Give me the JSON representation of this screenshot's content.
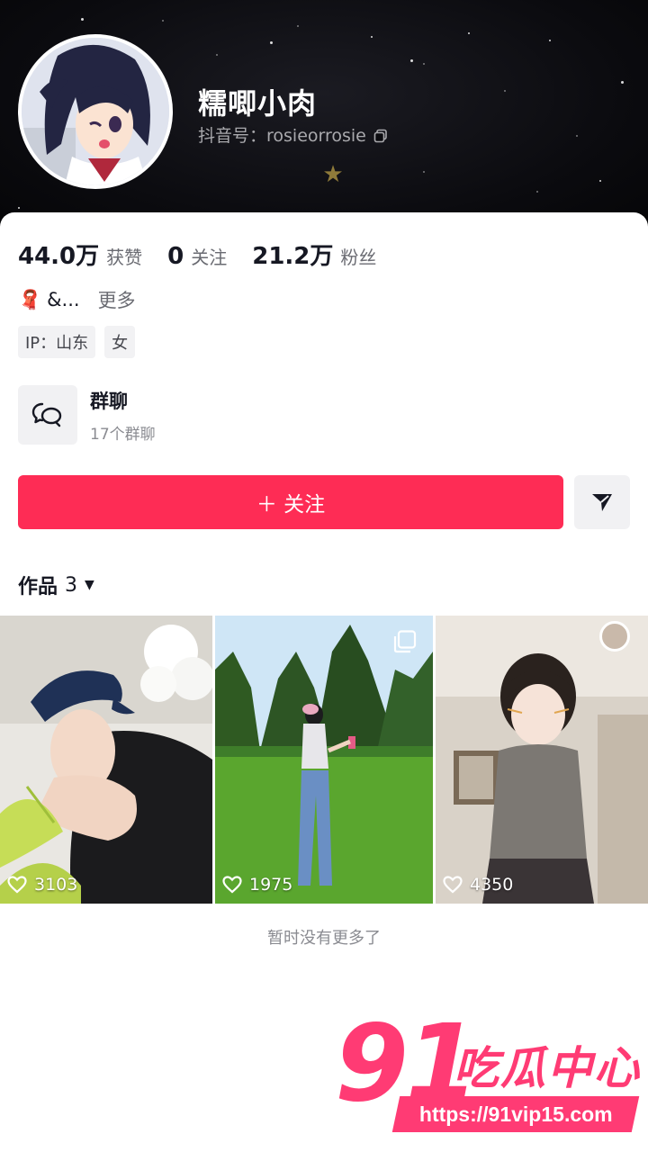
{
  "profile": {
    "name": "糯唧小肉",
    "douyin_id": "抖音号：rosieorrosie"
  },
  "stats": [
    {
      "value": "44.0万",
      "label": "获赞"
    },
    {
      "value": "0",
      "label": "关注"
    },
    {
      "value": "21.2万",
      "label": "粉丝"
    }
  ],
  "bio": {
    "emoji": "🧣",
    "text": "&...",
    "more": "更多"
  },
  "tags": [
    "IP：山东",
    "女"
  ],
  "group_chat": {
    "title": "群聊",
    "subtitle": "17个群聊"
  },
  "actions": {
    "follow": "＋ 关注"
  },
  "works": {
    "label": "作品",
    "count": "3"
  },
  "videos": [
    {
      "likes": "3103"
    },
    {
      "likes": "1975"
    },
    {
      "likes": "4350"
    }
  ],
  "footer": {
    "end_text": "暂时没有更多了"
  },
  "watermark": {
    "number": "91",
    "brand": "吃瓜中心",
    "url": "https://91vip15.com"
  },
  "colors": {
    "accent": "#fe2c55",
    "watermark": "#ff3b74"
  }
}
